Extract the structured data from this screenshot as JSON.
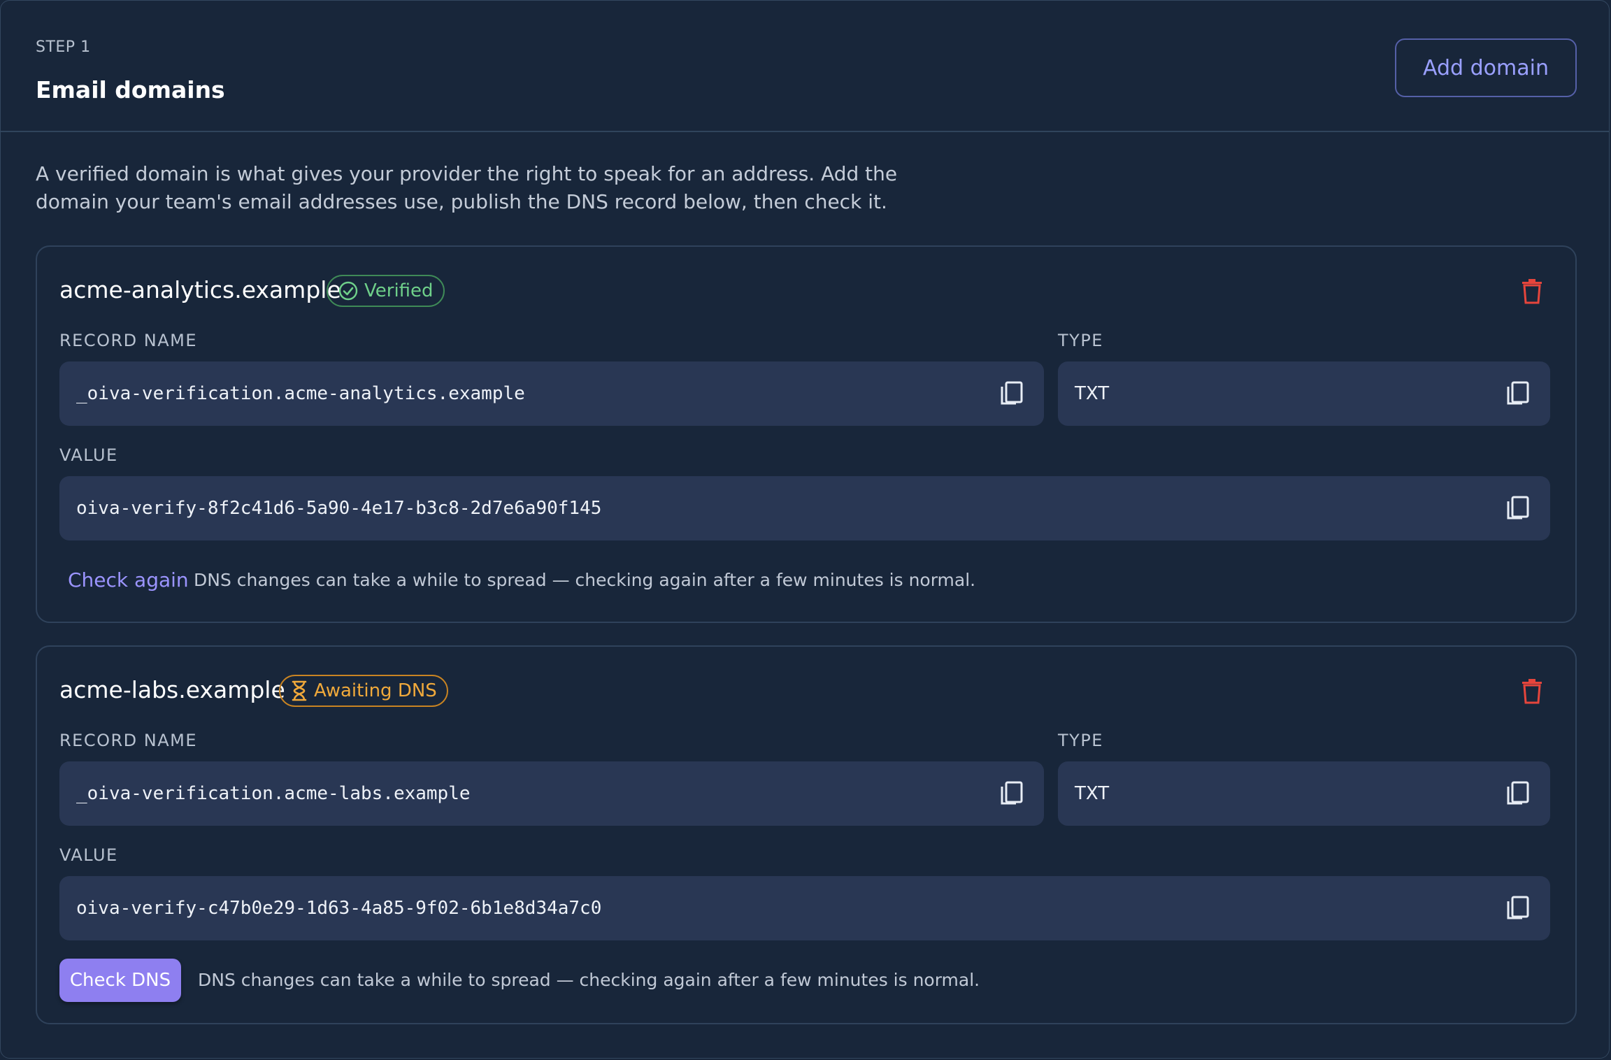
{
  "section": {
    "step": "STEP 1",
    "title": "Email domains",
    "add_button": "Add domain",
    "intro": "A verified domain is what gives your provider the right to speak for an address. Add the domain your team's email addresses use, publish the DNS record below, then check it."
  },
  "labels": {
    "record_name": "RECORD NAME",
    "type": "TYPE",
    "value": "VALUE"
  },
  "hint": "DNS changes can take a while to spread — checking again after a few minutes is normal.",
  "domains": [
    {
      "name": "acme-analytics.example",
      "status": "Verified",
      "status_icon": "check-circle-icon",
      "record_name": "_oiva-verification.acme-analytics.example",
      "type": "TXT",
      "value": "oiva-verify-8f2c41d6-5a90-4e17-b3c8-2d7e6a90f145",
      "action": "Check again"
    },
    {
      "name": "acme-labs.example",
      "status": "Awaiting DNS",
      "status_icon": "hourglass-icon",
      "record_name": "_oiva-verification.acme-labs.example",
      "type": "TXT",
      "value": "oiva-verify-c47b0e29-1d63-4a85-9f02-6b1e8d34a7c0",
      "action": "Check DNS"
    }
  ],
  "colors": {
    "background": "#18263a",
    "field": "#293754",
    "accent": "#9b94ff",
    "primary_button": "#8e7ff0",
    "verified": "#6fd08a",
    "awaiting": "#f0a93b",
    "danger": "#e5453c"
  }
}
